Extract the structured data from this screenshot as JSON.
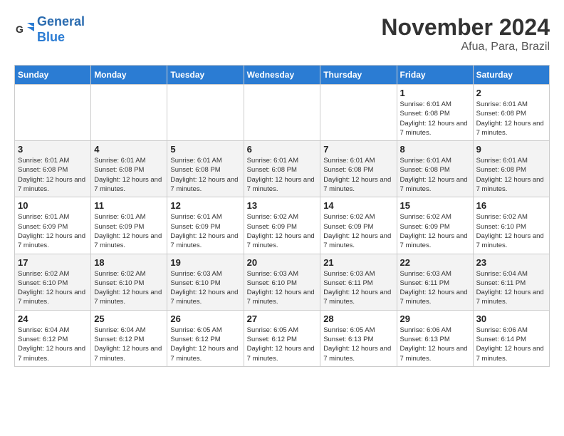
{
  "header": {
    "logo_line1": "General",
    "logo_line2": "Blue",
    "month_title": "November 2024",
    "location": "Afua, Para, Brazil"
  },
  "days_of_week": [
    "Sunday",
    "Monday",
    "Tuesday",
    "Wednesday",
    "Thursday",
    "Friday",
    "Saturday"
  ],
  "weeks": [
    [
      {
        "day": "",
        "info": ""
      },
      {
        "day": "",
        "info": ""
      },
      {
        "day": "",
        "info": ""
      },
      {
        "day": "",
        "info": ""
      },
      {
        "day": "",
        "info": ""
      },
      {
        "day": "1",
        "info": "Sunrise: 6:01 AM\nSunset: 6:08 PM\nDaylight: 12 hours and 7 minutes."
      },
      {
        "day": "2",
        "info": "Sunrise: 6:01 AM\nSunset: 6:08 PM\nDaylight: 12 hours and 7 minutes."
      }
    ],
    [
      {
        "day": "3",
        "info": "Sunrise: 6:01 AM\nSunset: 6:08 PM\nDaylight: 12 hours and 7 minutes."
      },
      {
        "day": "4",
        "info": "Sunrise: 6:01 AM\nSunset: 6:08 PM\nDaylight: 12 hours and 7 minutes."
      },
      {
        "day": "5",
        "info": "Sunrise: 6:01 AM\nSunset: 6:08 PM\nDaylight: 12 hours and 7 minutes."
      },
      {
        "day": "6",
        "info": "Sunrise: 6:01 AM\nSunset: 6:08 PM\nDaylight: 12 hours and 7 minutes."
      },
      {
        "day": "7",
        "info": "Sunrise: 6:01 AM\nSunset: 6:08 PM\nDaylight: 12 hours and 7 minutes."
      },
      {
        "day": "8",
        "info": "Sunrise: 6:01 AM\nSunset: 6:08 PM\nDaylight: 12 hours and 7 minutes."
      },
      {
        "day": "9",
        "info": "Sunrise: 6:01 AM\nSunset: 6:08 PM\nDaylight: 12 hours and 7 minutes."
      }
    ],
    [
      {
        "day": "10",
        "info": "Sunrise: 6:01 AM\nSunset: 6:09 PM\nDaylight: 12 hours and 7 minutes."
      },
      {
        "day": "11",
        "info": "Sunrise: 6:01 AM\nSunset: 6:09 PM\nDaylight: 12 hours and 7 minutes."
      },
      {
        "day": "12",
        "info": "Sunrise: 6:01 AM\nSunset: 6:09 PM\nDaylight: 12 hours and 7 minutes."
      },
      {
        "day": "13",
        "info": "Sunrise: 6:02 AM\nSunset: 6:09 PM\nDaylight: 12 hours and 7 minutes."
      },
      {
        "day": "14",
        "info": "Sunrise: 6:02 AM\nSunset: 6:09 PM\nDaylight: 12 hours and 7 minutes."
      },
      {
        "day": "15",
        "info": "Sunrise: 6:02 AM\nSunset: 6:09 PM\nDaylight: 12 hours and 7 minutes."
      },
      {
        "day": "16",
        "info": "Sunrise: 6:02 AM\nSunset: 6:10 PM\nDaylight: 12 hours and 7 minutes."
      }
    ],
    [
      {
        "day": "17",
        "info": "Sunrise: 6:02 AM\nSunset: 6:10 PM\nDaylight: 12 hours and 7 minutes."
      },
      {
        "day": "18",
        "info": "Sunrise: 6:02 AM\nSunset: 6:10 PM\nDaylight: 12 hours and 7 minutes."
      },
      {
        "day": "19",
        "info": "Sunrise: 6:03 AM\nSunset: 6:10 PM\nDaylight: 12 hours and 7 minutes."
      },
      {
        "day": "20",
        "info": "Sunrise: 6:03 AM\nSunset: 6:10 PM\nDaylight: 12 hours and 7 minutes."
      },
      {
        "day": "21",
        "info": "Sunrise: 6:03 AM\nSunset: 6:11 PM\nDaylight: 12 hours and 7 minutes."
      },
      {
        "day": "22",
        "info": "Sunrise: 6:03 AM\nSunset: 6:11 PM\nDaylight: 12 hours and 7 minutes."
      },
      {
        "day": "23",
        "info": "Sunrise: 6:04 AM\nSunset: 6:11 PM\nDaylight: 12 hours and 7 minutes."
      }
    ],
    [
      {
        "day": "24",
        "info": "Sunrise: 6:04 AM\nSunset: 6:12 PM\nDaylight: 12 hours and 7 minutes."
      },
      {
        "day": "25",
        "info": "Sunrise: 6:04 AM\nSunset: 6:12 PM\nDaylight: 12 hours and 7 minutes."
      },
      {
        "day": "26",
        "info": "Sunrise: 6:05 AM\nSunset: 6:12 PM\nDaylight: 12 hours and 7 minutes."
      },
      {
        "day": "27",
        "info": "Sunrise: 6:05 AM\nSunset: 6:12 PM\nDaylight: 12 hours and 7 minutes."
      },
      {
        "day": "28",
        "info": "Sunrise: 6:05 AM\nSunset: 6:13 PM\nDaylight: 12 hours and 7 minutes."
      },
      {
        "day": "29",
        "info": "Sunrise: 6:06 AM\nSunset: 6:13 PM\nDaylight: 12 hours and 7 minutes."
      },
      {
        "day": "30",
        "info": "Sunrise: 6:06 AM\nSunset: 6:14 PM\nDaylight: 12 hours and 7 minutes."
      }
    ]
  ]
}
